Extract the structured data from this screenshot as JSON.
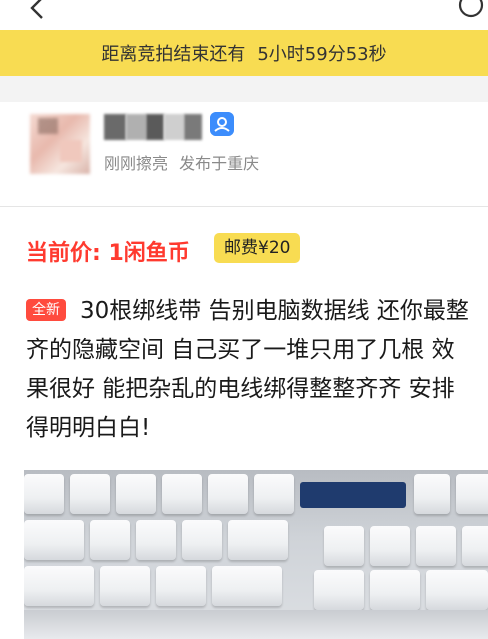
{
  "topbar": {
    "back_icon": "back-arrow-icon",
    "more_icon": "more-icon"
  },
  "countdown": {
    "prefix": "距离竞拍结束还有",
    "time": "5小时59分53秒",
    "bg_color": "#f8dc52"
  },
  "seller": {
    "status": "刚刚擦亮",
    "location": "发布于重庆",
    "badge_icon": "verified-icon",
    "badge_color": "#3c8dfc"
  },
  "price": {
    "label": "当前价: 1闲鱼币",
    "shipping": "邮费¥20",
    "accent": "#ff3a2f"
  },
  "listing": {
    "tag": "全新",
    "description": "30根绑线带 告别电脑数据线 还你最整齐的隐藏空间 自己买了一堆只用了几根 效果很好 能把杂乱的电线绑得整整齐齐 安排得明明白白!"
  }
}
